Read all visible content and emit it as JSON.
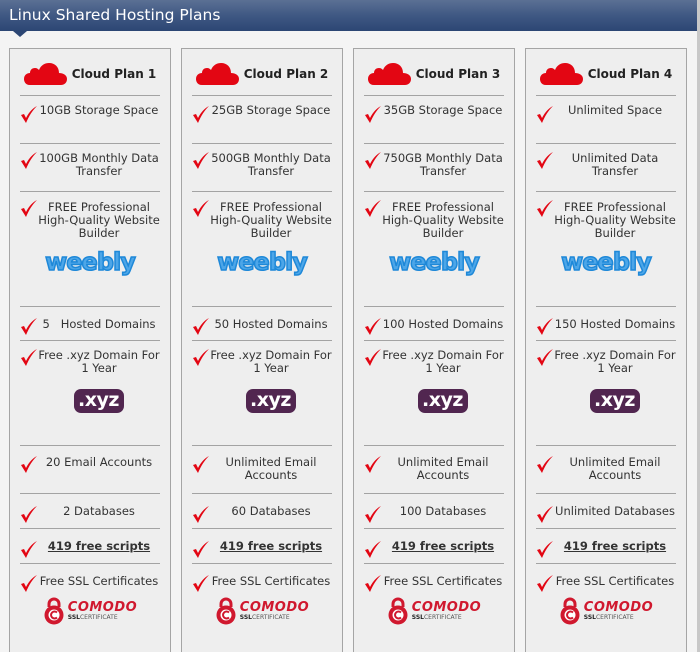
{
  "header": {
    "title": "Linux Shared Hosting Plans"
  },
  "colors": {
    "header_bg": "#2c4674",
    "check": "#e30613",
    "cloud": "#e30613",
    "weebly": "#1e88d8",
    "xyz": "#512650",
    "comodo": "#d0182e"
  },
  "icons": {
    "plan": "cloud-icon",
    "feature": "check-icon",
    "builder": "weebly-logo",
    "domain": "xyz-logo",
    "ssl": "comodo-ssl-logo"
  },
  "logos": {
    "weebly": "weebly",
    "xyz": ".xyz",
    "comodo_name": "COMODO",
    "comodo_sub_bold": "SSL",
    "comodo_sub": "CERTIFICATE"
  },
  "plans": [
    {
      "name": "Cloud Plan 1",
      "storage": "10GB Storage Space",
      "transfer": "100GB Monthly Data Transfer",
      "builder": "FREE Professional High-Quality Website Builder",
      "domains": "5   Hosted Domains",
      "free_domain": "Free .xyz Domain For 1 Year",
      "email": "20 Email Accounts",
      "databases": "2 Databases",
      "scripts": "419 free scripts",
      "ssl": "Free SSL Certificates"
    },
    {
      "name": "Cloud Plan 2",
      "storage": "25GB Storage Space",
      "transfer": "500GB Monthly Data Transfer",
      "builder": "FREE Professional High-Quality Website Builder",
      "domains": "50 Hosted Domains",
      "free_domain": "Free .xyz Domain For 1 Year",
      "email": "Unlimited Email Accounts",
      "databases": "60 Databases",
      "scripts": "419 free scripts",
      "ssl": "Free SSL Certificates"
    },
    {
      "name": "Cloud Plan 3",
      "storage": "35GB Storage Space",
      "transfer": "750GB Monthly Data Transfer",
      "builder": "FREE Professional High-Quality Website Builder",
      "domains": "100 Hosted Domains",
      "free_domain": "Free .xyz Domain For 1 Year",
      "email": "Unlimited Email Accounts",
      "databases": "100 Databases",
      "scripts": "419 free scripts",
      "ssl": "Free SSL Certificates"
    },
    {
      "name": "Cloud Plan 4",
      "storage": "Unlimited Space",
      "transfer": "Unlimited Data Transfer",
      "builder": "FREE Professional High-Quality Website Builder",
      "domains": "150 Hosted Domains",
      "free_domain": "Free .xyz Domain For 1 Year",
      "email": "Unlimited Email Accounts",
      "databases": "Unlimited Databases",
      "scripts": "419 free scripts",
      "ssl": "Free SSL Certificates"
    }
  ]
}
